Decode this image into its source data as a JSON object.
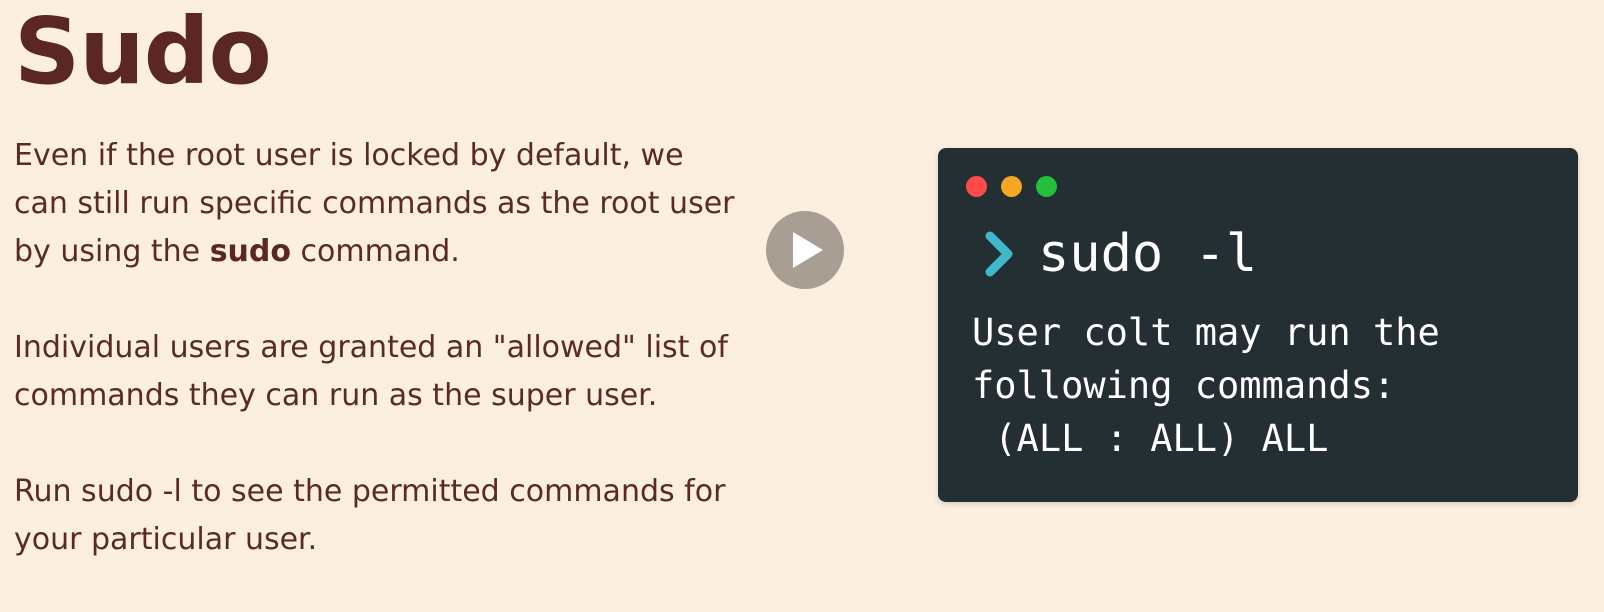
{
  "slide": {
    "title": "Sudo",
    "paragraph1": {
      "before": "Even if the root user is locked by default, we can still run specific commands as the root user by using the ",
      "bold": "sudo",
      "after": " command."
    },
    "paragraph2": "Individual users are granted an \"allowed\" list of commands they can run as the super user.",
    "paragraph3": "Run sudo -l to see the permitted commands for your particular user."
  },
  "terminal": {
    "command": "sudo -l",
    "output_lines": [
      "User colt may run the",
      "following commands:",
      " (ALL : ALL) ALL"
    ],
    "prompt_icon": "chevron-right-icon",
    "colors": {
      "background": "#242f33",
      "prompt": "#3fb8c9",
      "text": "#ffffff",
      "dot_red": "#ff4a4a",
      "dot_yellow": "#f5a623",
      "dot_green": "#22c03b"
    }
  },
  "player": {
    "icon": "play-icon"
  }
}
